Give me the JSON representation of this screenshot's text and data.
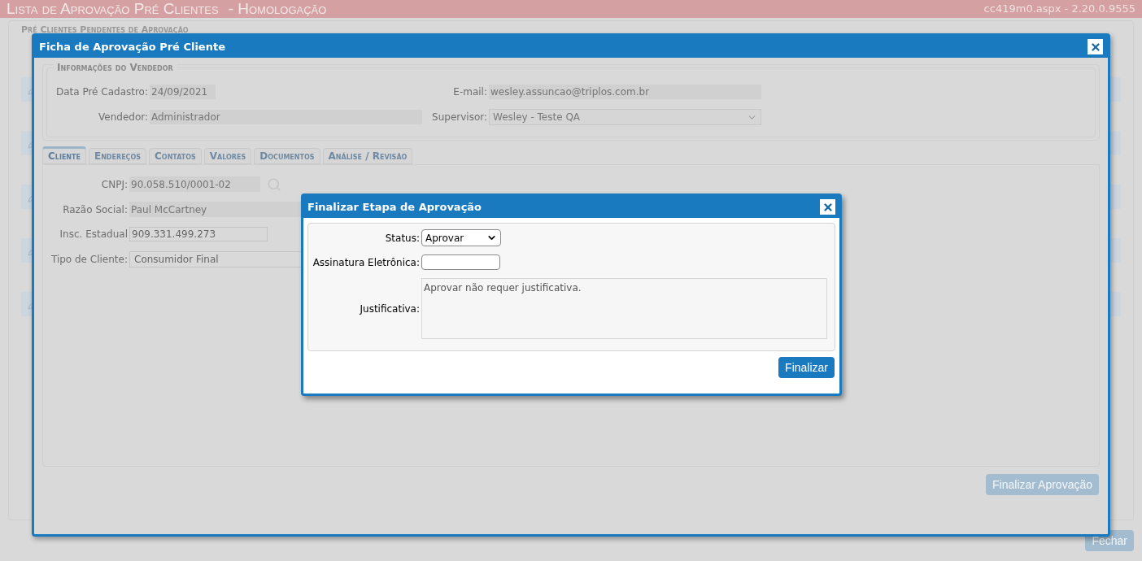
{
  "page": {
    "title": "Lista de Aprovação Pré Clientes",
    "environment": "- Homologação",
    "version": "cc419m0.aspx - 2.20.0.9555",
    "section_legend": "Pré Clientes Pendentes de Aprovação",
    "close_button": {
      "label": "Fechar",
      "disabled": true
    }
  },
  "record_dialog": {
    "title": "Ficha de Aprovação Pré Cliente",
    "seller_section": {
      "legend": "Informações do Vendedor",
      "fields": [
        {
          "label": "Data Pré Cadastro:",
          "value": "24/09/2021",
          "kind": "date"
        },
        {
          "label": "E-mail:",
          "value": "wesley.assuncao@triplos.com.br",
          "kind": "text"
        },
        {
          "label": "Vendedor:",
          "value": "Administrador",
          "kind": "text"
        },
        {
          "label": "Supervisor:",
          "value": "Wesley - Teste QA",
          "kind": "select"
        }
      ]
    },
    "tabs": [
      {
        "label": "Cliente",
        "selected": true
      },
      {
        "label": "Endereços",
        "selected": false
      },
      {
        "label": "Contatos",
        "selected": false
      },
      {
        "label": "Valores",
        "selected": false
      },
      {
        "label": "Documentos",
        "selected": false
      },
      {
        "label": "Análise / Revisão",
        "selected": false
      }
    ],
    "client_fields": [
      {
        "label": "CNPJ:",
        "value": "90.058.510/0001-02",
        "kind": "search"
      },
      {
        "label": "Razão Social:",
        "value": "Paul McCartney",
        "kind": "text"
      },
      {
        "label": "Insc. Estadual",
        "value": "909.331.499.273",
        "kind": "input"
      },
      {
        "label": "Tipo de Cliente:",
        "value": "Consumidor Final",
        "kind": "select"
      }
    ],
    "finish_button": {
      "label": "Finalizar Aprovação",
      "disabled": true
    }
  },
  "finish_dialog": {
    "title": "Finalizar Etapa de Aprovação",
    "fields": [
      {
        "label": "Status:",
        "value": "Aprovar",
        "kind": "select"
      },
      {
        "label": "Assinatura Eletrônica:",
        "kind": "input"
      },
      {
        "label": "Justificativa:",
        "value": "Aprovar não requer justificativa.",
        "kind": "textarea",
        "disabled": true
      }
    ],
    "button": {
      "label": "Finalizar",
      "disabled": false
    }
  }
}
